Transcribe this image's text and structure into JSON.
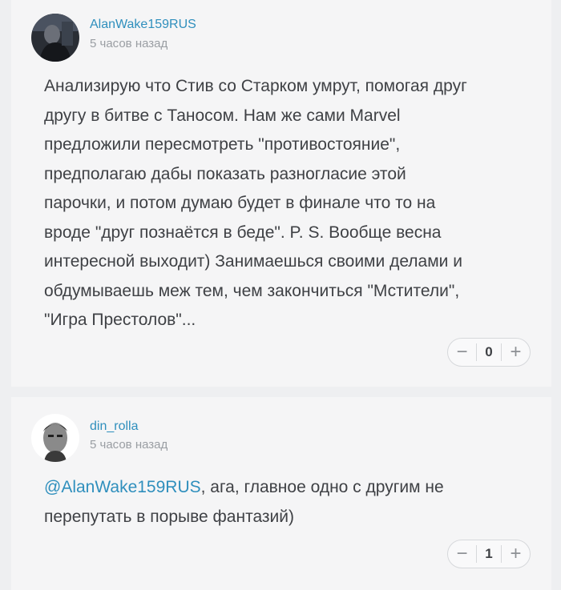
{
  "comments": [
    {
      "author": "AlanWake159RUS",
      "time": "5 часов назад",
      "lines": [
        "Анализирую что Стив со Старком умрут, помогая друг",
        "другу в битве с Таносом. Нам же сами Marvel",
        "предложили пересмотреть \"противостояние\",",
        "предполагаю дабы показать разногласие этой",
        "парочки, и потом думаю будет в финале что то на",
        "вроде \"друг познаётся в беде\". P. S. Вообще весна",
        "интересной выходит) Занимаешься своими делами и",
        "обдумываешь меж тем, чем закончиться \"Мстители\",",
        "\"Игра Престолов\"..."
      ],
      "rating": {
        "minus": "−",
        "value": "0",
        "plus": "+"
      }
    },
    {
      "author": "din_rolla",
      "time": "5 часов назад",
      "mention": "@AlanWake159RUS",
      "line1_rest": ", ага, главное одно с другим не",
      "line2": "перепутать в порыве фантазий)",
      "rating": {
        "minus": "−",
        "value": "1",
        "plus": "+"
      }
    }
  ]
}
